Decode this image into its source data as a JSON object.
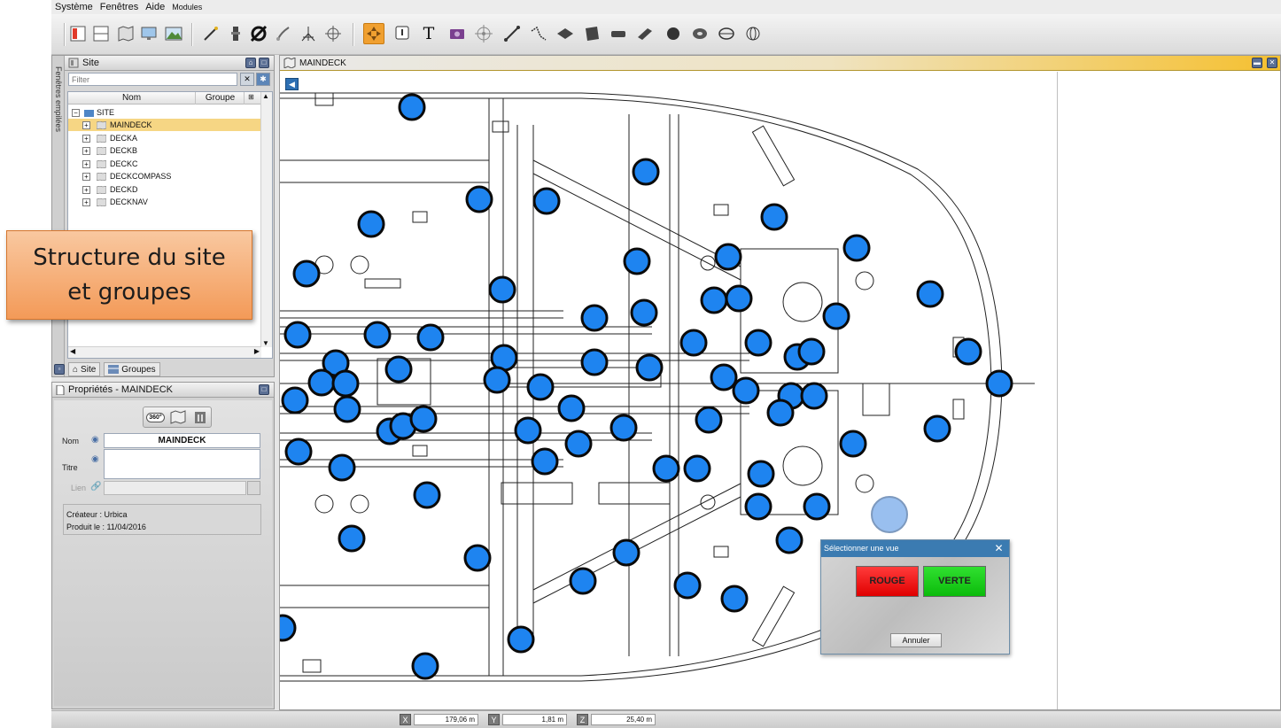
{
  "menu": {
    "items": [
      "Système",
      "Fenêtres",
      "Aide"
    ],
    "modules": "Modules"
  },
  "toolbar": {
    "icons": [
      "layout-icon",
      "split-view-icon",
      "map-view-icon",
      "screen-icon",
      "terrain-icon",
      "wand-icon",
      "tool-icon",
      "diameter-icon",
      "brush-icon",
      "tripod-icon",
      "compass-icon",
      "select-icon",
      "info-icon",
      "text-icon",
      "camera-icon",
      "target-icon",
      "line-icon",
      "polyline-icon",
      "diamond-icon",
      "polygon-icon",
      "box-icon",
      "slab-icon",
      "sphere-icon",
      "torus-icon",
      "ellipse-icon",
      "gyro-icon"
    ],
    "text_tool_glyph": "T"
  },
  "site_panel": {
    "side_tab": "Fenêtres empilées",
    "title": "Site",
    "filter_placeholder": "Filter",
    "col_name": "Nom",
    "col_group": "Groupe",
    "root": "SITE",
    "decks": [
      "MAINDECK",
      "DECKA",
      "DECKB",
      "DECKC",
      "DECKCOMPASS",
      "DECKD",
      "DECKNAV"
    ],
    "selected_index": 0,
    "tab_site": "Site",
    "tab_groups": "Groupes"
  },
  "callout": {
    "line1": "Structure du site",
    "line2": "et groupes"
  },
  "properties": {
    "title": "Propriétés - MAINDECK",
    "nom_label": "Nom",
    "nom_value": "MAINDECK",
    "titre_label": "Titre",
    "lien_label": "Lien",
    "createur_label": "Créateur :",
    "createur_value": "Urbica",
    "produit_label": "Produit le :",
    "produit_value": "11/04/2016",
    "icon_360": "360°"
  },
  "map_window": {
    "title": "MAINDECK"
  },
  "dialog": {
    "title": "Sélectionner une vue",
    "red_label": "ROUGE",
    "green_label": "VERTE",
    "cancel_label": "Annuler"
  },
  "status": {
    "x_label": "X",
    "x_value": "179,06 m",
    "y_label": "Y",
    "y_value": "1,81 m",
    "z_label": "Z",
    "z_value": "25,40 m"
  },
  "colors": {
    "marker": "#1e84f0",
    "marker_ghost": "#8eb9ee",
    "selection": "#f6d684",
    "accent": "#f0a030"
  }
}
